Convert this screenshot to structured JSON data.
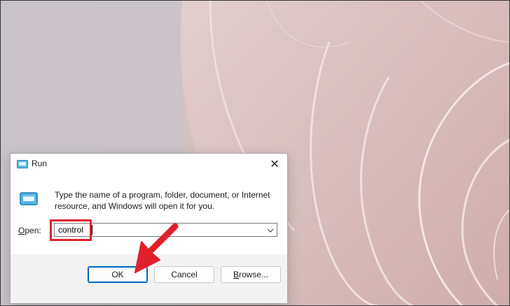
{
  "dialog": {
    "title": "Run",
    "description": "Type the name of a program, folder, document, or Internet resource, and Windows will open it for you.",
    "open_label_underlined": "O",
    "open_label_rest": "pen:",
    "open_value": "control",
    "ok_label": "OK",
    "cancel_label": "Cancel",
    "browse_label_underlined": "B",
    "browse_label_rest": "rowse...",
    "close_glyph": "✕"
  },
  "annotation": {
    "highlight_color": "#e0202a",
    "arrow_color": "#e0202a"
  },
  "icons": {
    "title_icon": "run-icon",
    "body_icon": "run-icon",
    "dropdown": "chevron-down-icon"
  }
}
